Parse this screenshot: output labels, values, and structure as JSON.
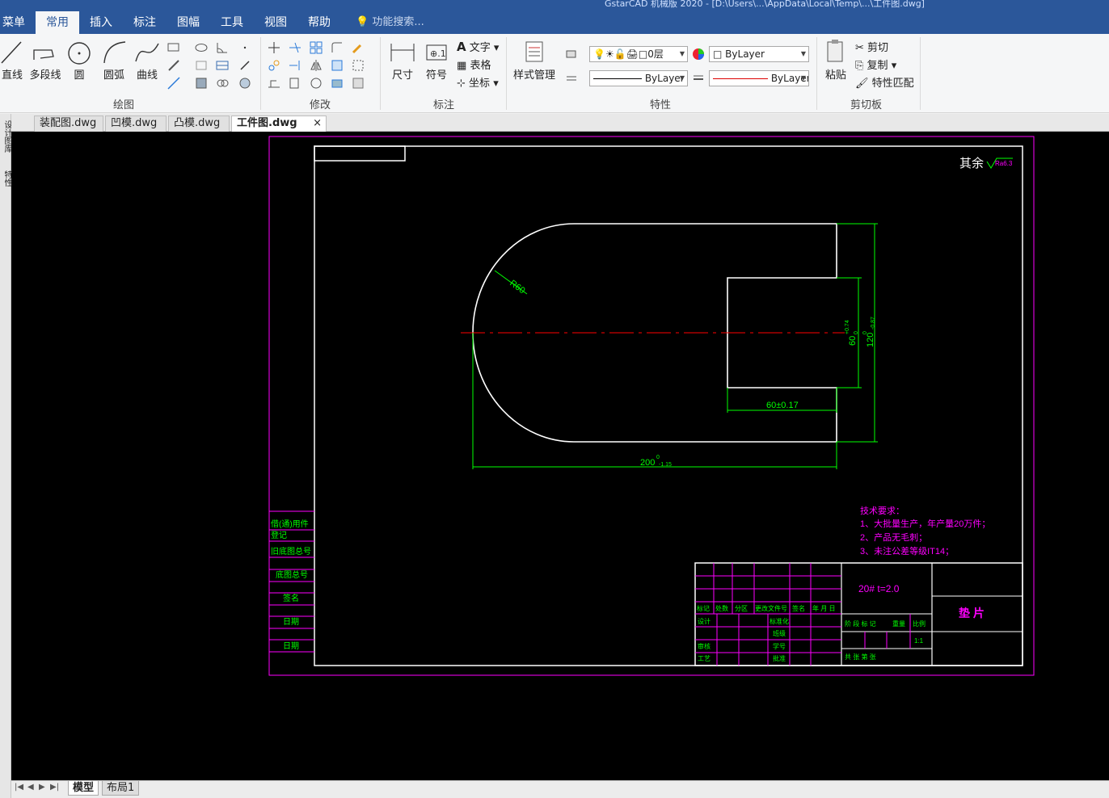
{
  "titlebar": {
    "title": "GstarCAD 机械版 2020 - [D:\\Users\\...\\AppData\\Local\\Temp\\...\\工件图.dwg]"
  },
  "menu": {
    "label": "菜单"
  },
  "ribbon_tabs": [
    "常用",
    "插入",
    "标注",
    "图幅",
    "工具",
    "视图",
    "帮助"
  ],
  "active_tab": "常用",
  "search": {
    "placeholder": "功能搜索..."
  },
  "groups": {
    "draw": {
      "label": "绘图",
      "line": "直线",
      "polyline": "多段线",
      "circle": "圆",
      "arc": "圆弧",
      "curve": "曲线"
    },
    "modify": {
      "label": "修改"
    },
    "annotate": {
      "label": "标注",
      "dimension": "尺寸",
      "symbol": "符号",
      "text": "文字",
      "table": "表格",
      "coord": "坐标"
    },
    "style": {
      "label": "样式管理"
    },
    "properties": {
      "label": "特性",
      "layer": "0层",
      "color": "ByLayer",
      "linetype": "ByLayer",
      "lineweight": "ByLayer"
    },
    "clipboard": {
      "label": "剪切板",
      "paste": "粘贴",
      "cut": "剪切",
      "copy": "复制",
      "match": "特性匹配"
    }
  },
  "doc_tabs": [
    {
      "label": "装配图.dwg",
      "active": false
    },
    {
      "label": "凹模.dwg",
      "active": false
    },
    {
      "label": "凸模.dwg",
      "active": false
    },
    {
      "label": "工件图.dwg",
      "active": true
    }
  ],
  "left_palette": {
    "a": "设计图库",
    "b": "特性"
  },
  "bottom_tabs": [
    {
      "label": "模型",
      "active": true
    },
    {
      "label": "布局1",
      "active": false
    }
  ],
  "drawing": {
    "roughness_prefix": "其余",
    "roughness_value": "Ra6.3",
    "radius_label": "R60",
    "dim_60_v": "60",
    "dim_60_v_tol": "+0.74",
    "dim_60_v_tol2": "0",
    "dim_120": "120",
    "dim_120_tol": "-0.87",
    "dim_120_tol2": "0",
    "dim_60_h": "60±0.17",
    "dim_200": "200",
    "dim_200_tol": "-1.15",
    "dim_200_tol2": "0",
    "tech_title": "技术要求：",
    "tech_1": "1、大批量生产，年产量20万件；",
    "tech_2": "2、产品无毛刺；",
    "tech_3": "3、未注公差等级IT14；",
    "left_table": [
      "借(通)用件",
      "登记",
      "旧底图总号",
      "底图总号",
      "签名",
      "日期",
      "日期"
    ],
    "title_block": {
      "material": "20#  t=2.0",
      "part_name": "垫    片",
      "rev_headers": [
        "标记",
        "处数",
        "分区",
        "更改文件号",
        "签名",
        "年 月 日"
      ],
      "rows": [
        "设计",
        "审核",
        "工艺"
      ],
      "mid_labels": [
        "标准化",
        "班级",
        "学号",
        "批准"
      ],
      "stage_labels": [
        "阶 段 标 记",
        "重量",
        "比例"
      ],
      "scale": "1:1",
      "sheet": "共      张   第      张"
    },
    "colors": {
      "white": "#ffffff",
      "green": "#00ff00",
      "magenta": "#ff00ff",
      "red": "#ff0000"
    }
  }
}
